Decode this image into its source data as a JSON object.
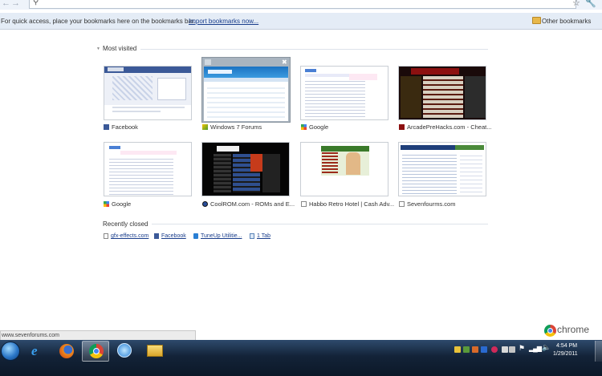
{
  "browser": {
    "name": "chrome",
    "bookmarks_bar": {
      "message": "For quick access, place your bookmarks here on the bookmarks bar.",
      "import_link": "Import bookmarks now...",
      "other_bookmarks": "Other bookmarks"
    },
    "status_url": "www.sevenforums.com"
  },
  "new_tab": {
    "most_visited_title": "Most visited",
    "thumbnails": [
      {
        "label": "Facebook",
        "favicon": "facebook-icon"
      },
      {
        "label": "Windows 7 Forums",
        "favicon": "sevenforums-icon"
      },
      {
        "label": "Google",
        "favicon": "google-icon"
      },
      {
        "label": "ArcadePreHacks.com - Cheat...",
        "favicon": "arcade-icon"
      },
      {
        "label": "Google",
        "favicon": "google-icon"
      },
      {
        "label": "CoolROM.com - ROMs and E...",
        "favicon": "coolrom-icon"
      },
      {
        "label": "Habbo Retro Hotel | Cash Adv...",
        "favicon": "page-icon"
      },
      {
        "label": "Sevenfourms.com",
        "favicon": "page-icon"
      }
    ],
    "recently_closed_title": "Recently closed",
    "recently_closed": [
      {
        "label": "gfx-effects.com",
        "icon": "page-icon"
      },
      {
        "label": "Facebook",
        "icon": "facebook-icon"
      },
      {
        "label": "TuneUp Utilitie...",
        "icon": "tuneup-icon"
      },
      {
        "label": "1 Tab",
        "icon": "window-icon"
      }
    ]
  },
  "taskbar": {
    "apps": [
      "internet-explorer-icon",
      "firefox-icon",
      "chrome-icon",
      "itunes-icon",
      "explorer-icon"
    ],
    "clock_time": "4:54 PM",
    "clock_date": "1/29/2011"
  },
  "colors": {
    "bookmarks_bar": "#e4ecf6",
    "link": "#1a3e8c",
    "taskbar": "#132338"
  }
}
